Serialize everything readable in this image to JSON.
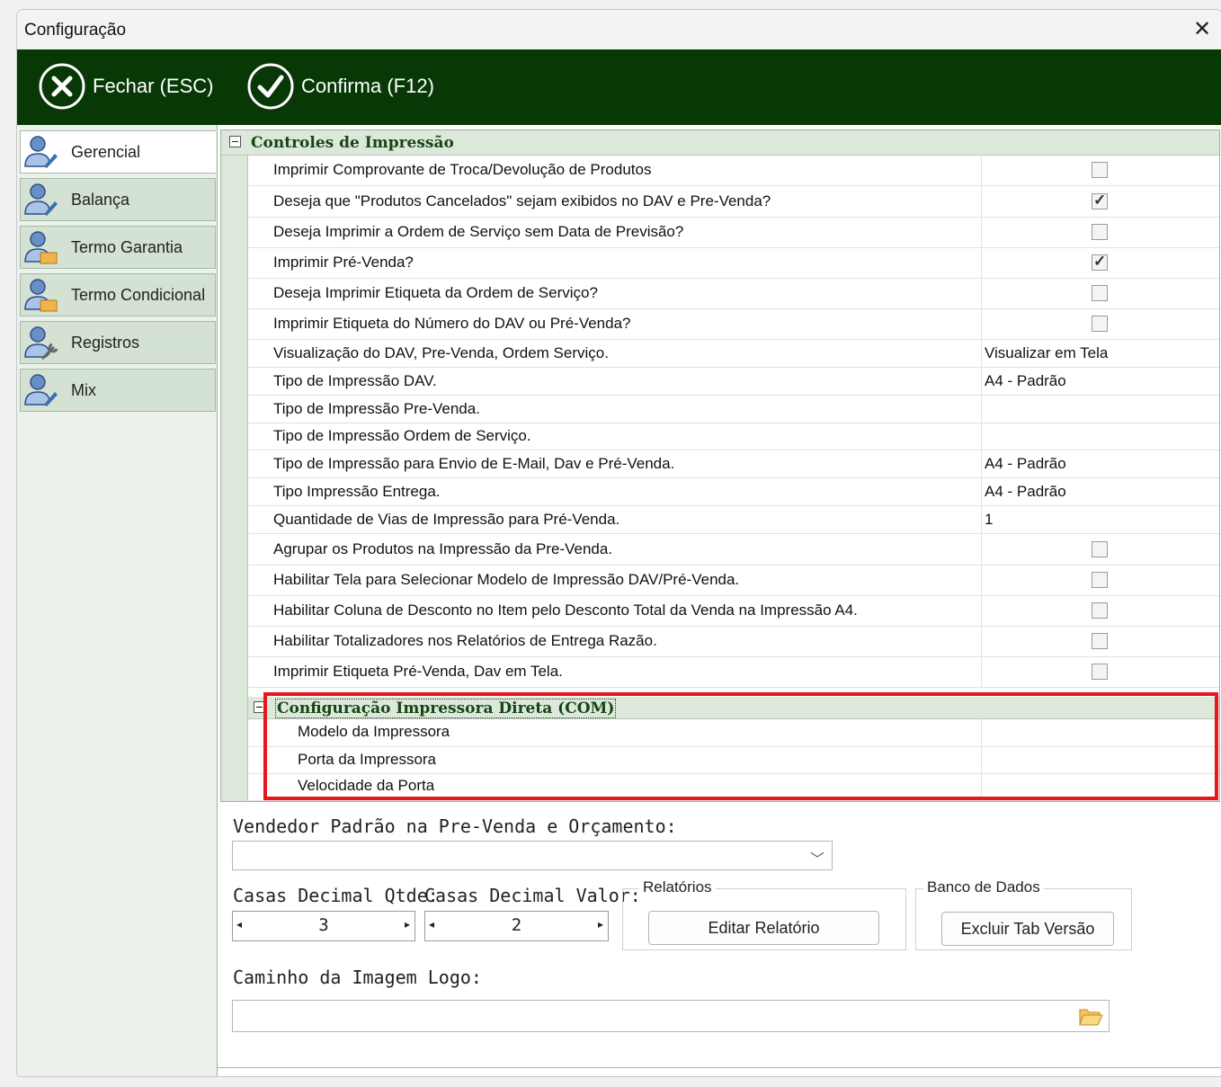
{
  "window": {
    "title": "Configuração",
    "close": "✕"
  },
  "toolbar": {
    "close_label": "Fechar (ESC)",
    "confirm_label": "Confirma (F12)"
  },
  "sidebar": {
    "items": [
      {
        "label": "Gerencial",
        "icon": "user-pen-icon",
        "active": true
      },
      {
        "label": "Balança",
        "icon": "user-pen-icon"
      },
      {
        "label": "Termo Garantia",
        "icon": "user-folder-icon"
      },
      {
        "label": "Termo Condicional",
        "icon": "user-folder-icon"
      },
      {
        "label": "Registros",
        "icon": "user-wrench-icon"
      },
      {
        "label": "Mix",
        "icon": "user-pen-icon"
      }
    ]
  },
  "grid": {
    "category": "Controles de Impressão",
    "rows": [
      {
        "name": "Imprimir Comprovante de Troca/Devolução de Produtos",
        "type": "checkbox",
        "checked": false
      },
      {
        "name": "Deseja que \"Produtos Cancelados\" sejam exibidos no DAV e Pre-Venda?",
        "type": "checkbox",
        "checked": true
      },
      {
        "name": "Deseja Imprimir a Ordem de Serviço sem Data de Previsão?",
        "type": "checkbox",
        "checked": false
      },
      {
        "name": "Imprimir Pré-Venda?",
        "type": "checkbox",
        "checked": true
      },
      {
        "name": "Deseja Imprimir Etiqueta da Ordem de Serviço?",
        "type": "checkbox",
        "checked": false
      },
      {
        "name": "Imprimir Etiqueta do Número do DAV ou Pré-Venda?",
        "type": "checkbox",
        "checked": false
      },
      {
        "name": "Visualização do DAV,  Pre-Venda, Ordem Serviço.",
        "type": "text",
        "value": "Visualizar em Tela"
      },
      {
        "name": "Tipo de Impressão DAV.",
        "type": "text",
        "value": "A4 - Padrão"
      },
      {
        "name": "Tipo de Impressão Pre-Venda.",
        "type": "text",
        "value": ""
      },
      {
        "name": "Tipo de Impressão Ordem de Serviço.",
        "type": "text",
        "value": ""
      },
      {
        "name": "Tipo de Impressão para Envio de E-Mail, Dav e Pré-Venda.",
        "type": "text",
        "value": "A4 - Padrão"
      },
      {
        "name": "Tipo Impressão Entrega.",
        "type": "text",
        "value": "A4 - Padrão"
      },
      {
        "name": "Quantidade de Vias de Impressão para Pré-Venda.",
        "type": "text",
        "value": "1"
      },
      {
        "name": "Agrupar os Produtos na Impressão da Pre-Venda.",
        "type": "checkbox",
        "checked": false
      },
      {
        "name": "Habilitar Tela para Selecionar Modelo de Impressão DAV/Pré-Venda.",
        "type": "checkbox",
        "checked": false
      },
      {
        "name": "Habilitar Coluna de Desconto no Item pelo Desconto Total da Venda na Impressão A4.",
        "type": "checkbox",
        "checked": false
      },
      {
        "name": "Habilitar Totalizadores nos Relatórios de Entrega Razão.",
        "type": "checkbox",
        "checked": false
      },
      {
        "name": "Imprimir Etiqueta Pré-Venda, Dav em Tela.",
        "type": "checkbox",
        "checked": false
      }
    ],
    "subcategory": "Configuração Impressora Direta (COM)",
    "subrows": [
      {
        "name": "Modelo da Impressora",
        "value": ""
      },
      {
        "name": "Porta da Impressora",
        "value": ""
      },
      {
        "name": "Velocidade da Porta",
        "value": ""
      }
    ]
  },
  "form": {
    "vendedor_label": "Vendedor Padrão na Pre-Venda e Orçamento:",
    "vendedor_value": "",
    "qtde_label": "Casas Decimal Qtde:",
    "qtde_value": "3",
    "valor_label": "Casas Decimal Valor:",
    "valor_value": "2",
    "relatorios_group": "Relatórios",
    "editar_relatorio": "Editar Relatório",
    "banco_group": "Banco de Dados",
    "excluir_tab": "Excluir Tab Versão",
    "logo_label": "Caminho da Imagem Logo:",
    "logo_value": ""
  },
  "colors": {
    "toolbar_bg": "#073806",
    "category_text": "#164515",
    "highlight_red": "#e8161d"
  }
}
